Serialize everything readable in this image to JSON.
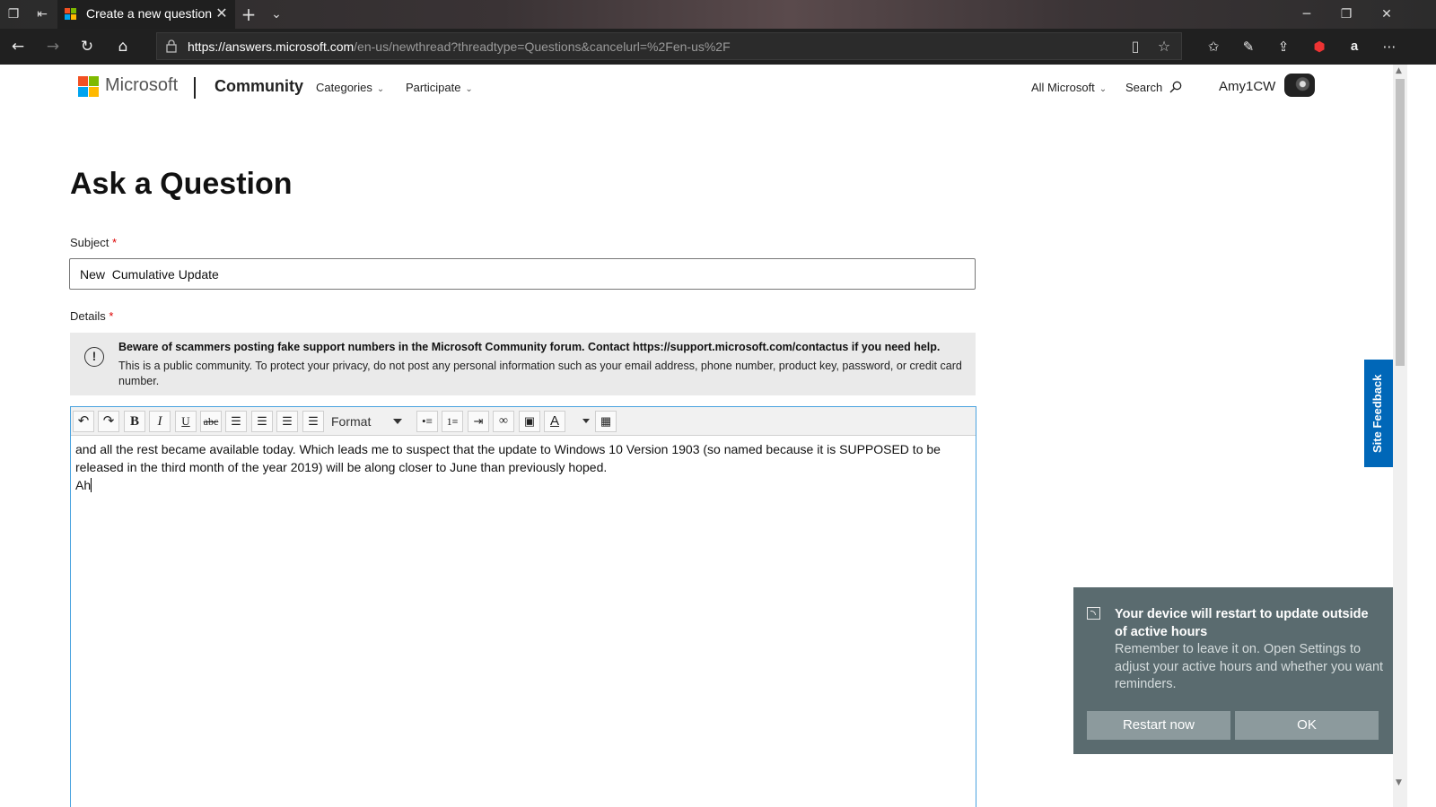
{
  "browser": {
    "tab_title": "Create a new question",
    "url_domain": "https://answers.microsoft.com",
    "url_path": "/en-us/newthread?threadtype=Questions&cancelurl=%2Fen-us%2F"
  },
  "header": {
    "brand": "Microsoft",
    "community": "Community",
    "nav": [
      "Categories",
      "Participate"
    ],
    "all_microsoft": "All Microsoft",
    "search": "Search",
    "username": "Amy1CW"
  },
  "form": {
    "title": "Ask a Question",
    "subject_label": "Subject",
    "required_mark": "*",
    "subject_value": "New  Cumulative Update",
    "details_label": "Details",
    "notice_bold": "Beware of scammers posting fake support numbers in the Microsoft Community forum. Contact https://support.microsoft.com/contactus if you need help.",
    "notice_text": "This is a public community. To protect your privacy, do not post any personal information such as your email address, phone number, product key, password, or credit card number.",
    "format_label": "Format",
    "editor_line1": "and all the rest became available today. Which leads me to suspect that the update to Windows 10 Version 1903 (so named because it is SUPPOSED to be released in the third month of the year 2019) will be along closer to June than previously hoped.",
    "editor_line2": "Ah"
  },
  "site_feedback": "Site Feedback",
  "toast": {
    "title": "Your device will restart to update outside of active hours",
    "body": "Remember to leave it on. Open Settings to adjust your active hours and whether you want reminders.",
    "restart_label": "Restart now",
    "ok_label": "OK"
  },
  "colors": {
    "accent": "#0067b8",
    "toast_bg": "#5a6b6f",
    "toast_btn": "#8c9a9d",
    "required": "#dd0000"
  }
}
